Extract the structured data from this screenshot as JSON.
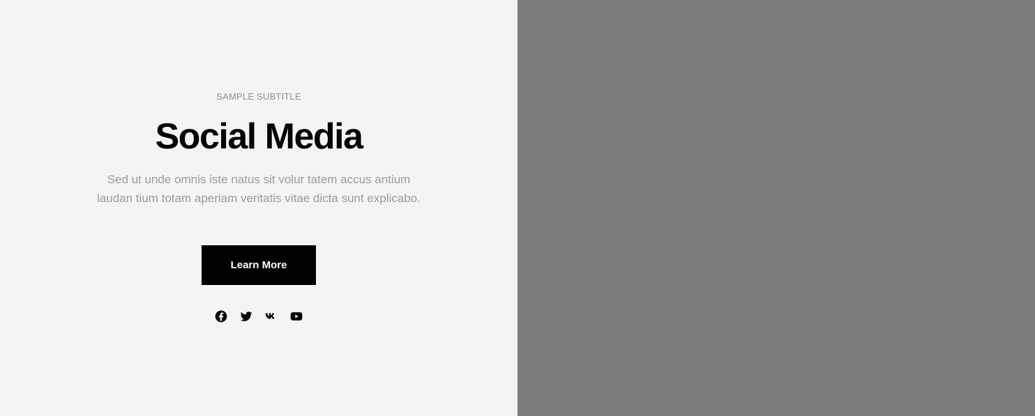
{
  "hero": {
    "subtitle": "SAMPLE SUBTITLE",
    "title": "Social Media",
    "description": "Sed ut unde omnis iste natus sit volur tatem accus antium laudan tium totam aperiam veritatis vitae dicta sunt explicabo.",
    "button_label": "Learn More"
  },
  "social": {
    "icons": [
      "facebook-icon",
      "twitter-icon",
      "vk-icon",
      "youtube-icon"
    ]
  },
  "colors": {
    "left_background": "#f4f4f4",
    "right_background": "#7a7b7d",
    "button_background": "#000000",
    "button_text": "#ffffff",
    "title": "#050505",
    "muted_text": "#9b9b9b"
  }
}
